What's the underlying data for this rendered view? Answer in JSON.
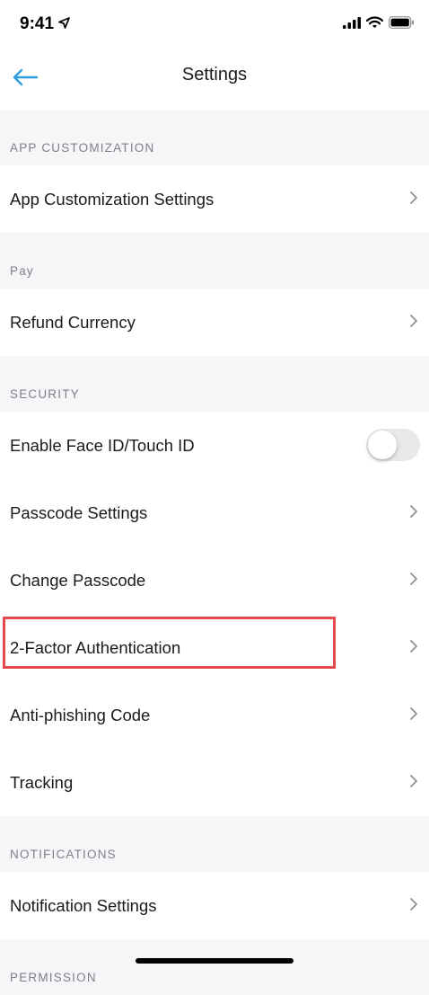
{
  "status": {
    "time": "9:41"
  },
  "nav": {
    "title": "Settings"
  },
  "sections": {
    "app_customization": {
      "header": "APP CUSTOMIZATION",
      "items": [
        "App Customization Settings"
      ]
    },
    "pay": {
      "header": "Pay",
      "items": [
        "Refund Currency"
      ]
    },
    "security": {
      "header": "SECURITY",
      "face_id_label": "Enable Face ID/Touch ID",
      "face_id_enabled": false,
      "items": [
        "Passcode Settings",
        "Change Passcode",
        "2-Factor Authentication",
        "Anti-phishing Code",
        "Tracking"
      ]
    },
    "notifications": {
      "header": "NOTIFICATIONS",
      "items": [
        "Notification Settings"
      ]
    },
    "permission": {
      "header": "PERMISSION"
    }
  },
  "colors": {
    "accent": "#2f9ee0",
    "highlight": "#e5484d",
    "background": "#f6f6f8"
  }
}
